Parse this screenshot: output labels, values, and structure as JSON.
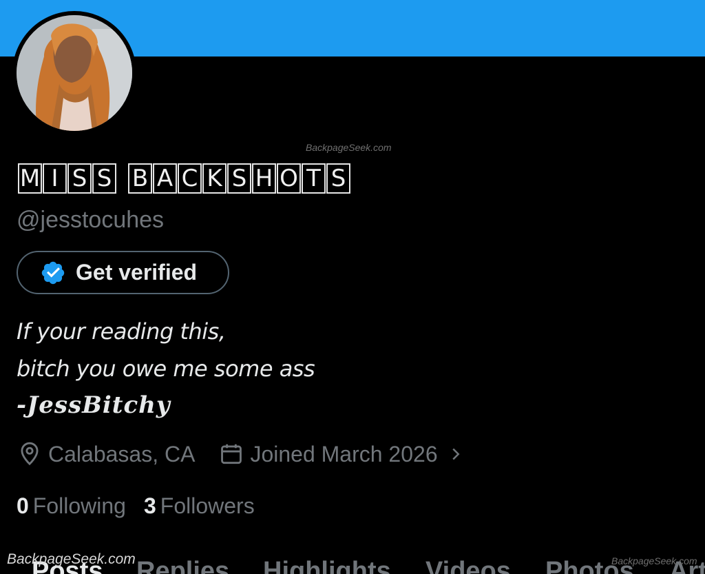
{
  "profile": {
    "display_name_letters": [
      "M",
      "I",
      "S",
      "S",
      " ",
      "B",
      "A",
      "C",
      "K",
      "S",
      "H",
      "O",
      "T",
      "S"
    ],
    "handle": "@jesstocuhes",
    "verify_button_label": "Get verified",
    "bio_line1": "If your reading this,",
    "bio_line2": "bitch you owe me some ass",
    "bio_signature": "-JessBitchy",
    "location": "Calabasas, CA",
    "joined": "Joined March 2026",
    "following_count": "0",
    "following_label": "Following",
    "followers_count": "3",
    "followers_label": "Followers"
  },
  "tabs": [
    {
      "label": "Posts",
      "active": true
    },
    {
      "label": "Replies",
      "active": false
    },
    {
      "label": "Highlights",
      "active": false
    },
    {
      "label": "Videos",
      "active": false
    },
    {
      "label": "Photos",
      "active": false
    },
    {
      "label": "Art",
      "active": false
    }
  ],
  "watermarks": {
    "top": "BackpageSeek.com",
    "bottom_left": "BackpageSeek.com",
    "bottom_right": "BackpageSeek.com"
  },
  "icons": {
    "verified": "verified-badge-icon",
    "location": "location-pin-icon",
    "calendar": "calendar-icon",
    "chevron": "chevron-right-icon"
  },
  "colors": {
    "banner": "#1d9bf0",
    "background": "#000000",
    "primary_text": "#e7e9ea",
    "secondary_text": "#71767b",
    "verified_blue": "#1d9bf0"
  }
}
